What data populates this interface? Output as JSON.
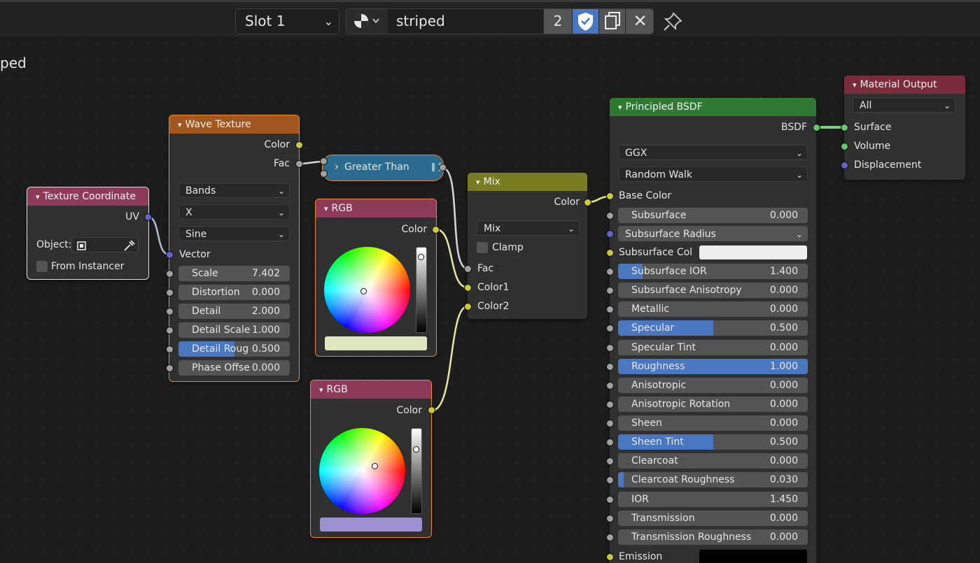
{
  "header": {
    "slot": "Slot 1",
    "material_name": "striped",
    "users_count": "2",
    "title_fragment": "ped"
  },
  "nodes": {
    "tex_coord": {
      "title": "Texture Coordinate",
      "uv": "UV",
      "object_label": "Object:",
      "from_instancer": "From Instancer",
      "header_color": "#8e3b5a"
    },
    "wave": {
      "title": "Wave Texture",
      "out_color": "Color",
      "out_fac": "Fac",
      "type": "Bands",
      "direction": "X",
      "profile": "Sine",
      "in_vector": "Vector",
      "fields": [
        {
          "label": "Scale",
          "value": "7.402",
          "fill": 0
        },
        {
          "label": "Distortion",
          "value": "0.000",
          "fill": 0
        },
        {
          "label": "Detail",
          "value": "2.000",
          "fill": 0
        },
        {
          "label": "Detail Scale",
          "value": "1.000",
          "fill": 0
        },
        {
          "label": "Detail Roug",
          "value": "0.500",
          "fill": 0.5
        },
        {
          "label": "Phase Offse",
          "value": "0.000",
          "fill": 0
        }
      ],
      "header_color": "#a2571e"
    },
    "greater": {
      "title": "Greater Than",
      "color": "#2a6b8f"
    },
    "rgb1": {
      "title": "RGB",
      "out_color": "Color",
      "swatch": "#dce6c0",
      "header_color": "#8e3b5a"
    },
    "rgb2": {
      "title": "RGB",
      "out_color": "Color",
      "swatch": "#9c8fd2",
      "header_color": "#8e3b5a"
    },
    "mix": {
      "title": "Mix",
      "out_color": "Color",
      "blend": "Mix",
      "clamp": "Clamp",
      "inputs": [
        "Fac",
        "Color1",
        "Color2"
      ],
      "header_color": "#7b7b22"
    },
    "bsdf": {
      "title": "Principled BSDF",
      "out": "BSDF",
      "distribution": "GGX",
      "subsurface_method": "Random Walk",
      "base_color": "Base Color",
      "subsurface_radius": "Subsurface Radius",
      "subsurface_col": "Subsurface Col",
      "emission": "Emission",
      "fields": [
        {
          "label": "Subsurface",
          "value": "0.000",
          "fill": 0
        },
        {
          "label": "Subsurface IOR",
          "value": "1.400",
          "fill": 0.13
        },
        {
          "label": "Subsurface Anisotropy",
          "value": "0.000",
          "fill": 0
        },
        {
          "label": "Metallic",
          "value": "0.000",
          "fill": 0
        },
        {
          "label": "Specular",
          "value": "0.500",
          "fill": 0.5
        },
        {
          "label": "Specular Tint",
          "value": "0.000",
          "fill": 0
        },
        {
          "label": "Roughness",
          "value": "1.000",
          "fill": 1
        },
        {
          "label": "Anisotropic",
          "value": "0.000",
          "fill": 0
        },
        {
          "label": "Anisotropic Rotation",
          "value": "0.000",
          "fill": 0
        },
        {
          "label": "Sheen",
          "value": "0.000",
          "fill": 0
        },
        {
          "label": "Sheen Tint",
          "value": "0.500",
          "fill": 0.5
        },
        {
          "label": "Clearcoat",
          "value": "0.000",
          "fill": 0
        },
        {
          "label": "Clearcoat Roughness",
          "value": "0.030",
          "fill": 0.03
        },
        {
          "label": "IOR",
          "value": "1.450",
          "fill": 0
        },
        {
          "label": "Transmission",
          "value": "0.000",
          "fill": 0
        },
        {
          "label": "Transmission Roughness",
          "value": "0.000",
          "fill": 0
        }
      ],
      "header_color": "#2f7a33"
    },
    "output": {
      "title": "Material Output",
      "target": "All",
      "inputs": [
        "Surface",
        "Volume",
        "Displacement"
      ],
      "header_color": "#7a2b3c"
    }
  }
}
